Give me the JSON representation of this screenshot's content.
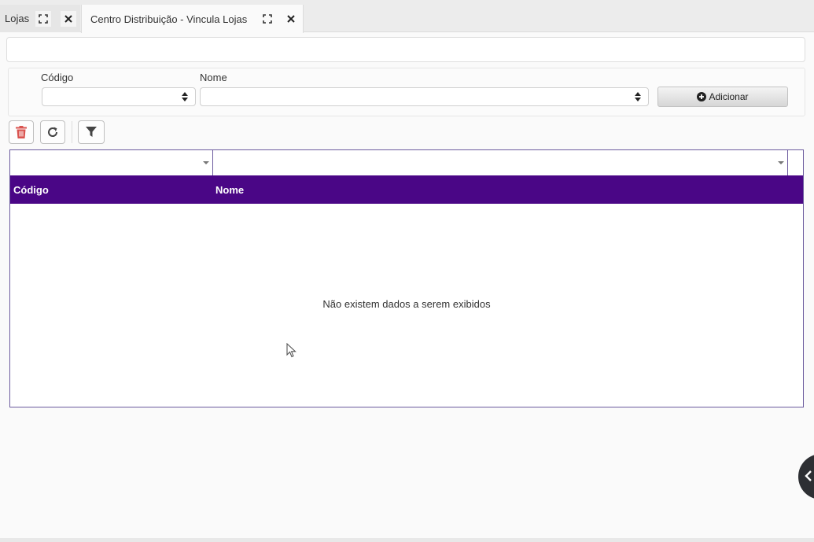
{
  "tabs": [
    {
      "label": "Lojas",
      "expand_icon": "expand-icon",
      "close_icon": "close-icon"
    },
    {
      "label": "Centro Distribuição - Vincula Lojas",
      "expand_icon": "expand-icon",
      "close_icon": "close-icon",
      "active": true
    }
  ],
  "form": {
    "codigo_label": "Código",
    "nome_label": "Nome",
    "codigo_value": "",
    "nome_value": "",
    "add_button_label": "Adicionar",
    "add_button_icon": "plus-circle-icon"
  },
  "toolbar": {
    "delete_icon": "trash-icon",
    "refresh_icon": "refresh-icon",
    "filter_icon": "filter-icon"
  },
  "grid": {
    "columns": [
      "Código",
      "Nome"
    ],
    "rows": [],
    "empty_message": "Não existem dados a serem exibidos"
  },
  "colors": {
    "header_bg": "#4a0686",
    "grid_border": "#6c5b9e",
    "delete_icon": "#d9534f"
  }
}
